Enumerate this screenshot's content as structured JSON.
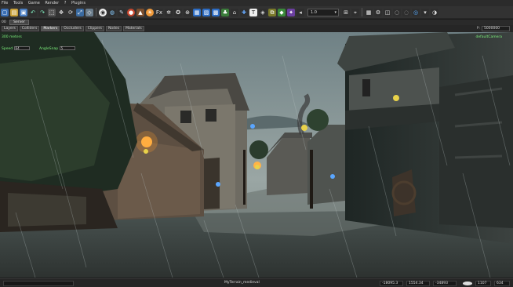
{
  "menu": [
    "File",
    "Tools",
    "Game",
    "Render",
    "?",
    "Plugins"
  ],
  "toolbar": {
    "zoom_value": "1.0"
  },
  "panel_strip": {
    "items": [
      "00",
      "Server"
    ]
  },
  "tabs": [
    {
      "label": "Layers",
      "active": false
    },
    {
      "label": "Colliders",
      "active": false
    },
    {
      "label": "Markers",
      "active": true
    },
    {
      "label": "Occluders",
      "active": false
    },
    {
      "label": "Clippers",
      "active": false
    },
    {
      "label": "Nodes",
      "active": false
    },
    {
      "label": "Materials",
      "active": false
    }
  ],
  "coord_box": {
    "label": "P:",
    "value": "5000000"
  },
  "viewport": {
    "distance_text": "300 meters",
    "camera_label": "defaultCamera",
    "speed_label": "Speed",
    "speed_value": "64",
    "angle_snap_label": "AngleSnap",
    "angle_snap_value": "5"
  },
  "status": {
    "left_field": "",
    "filename": "MyTerrain_medieval",
    "x": "-18095.3",
    "y": "1554.34",
    "z": "-34893",
    "fps": "1107",
    "count": "634"
  }
}
